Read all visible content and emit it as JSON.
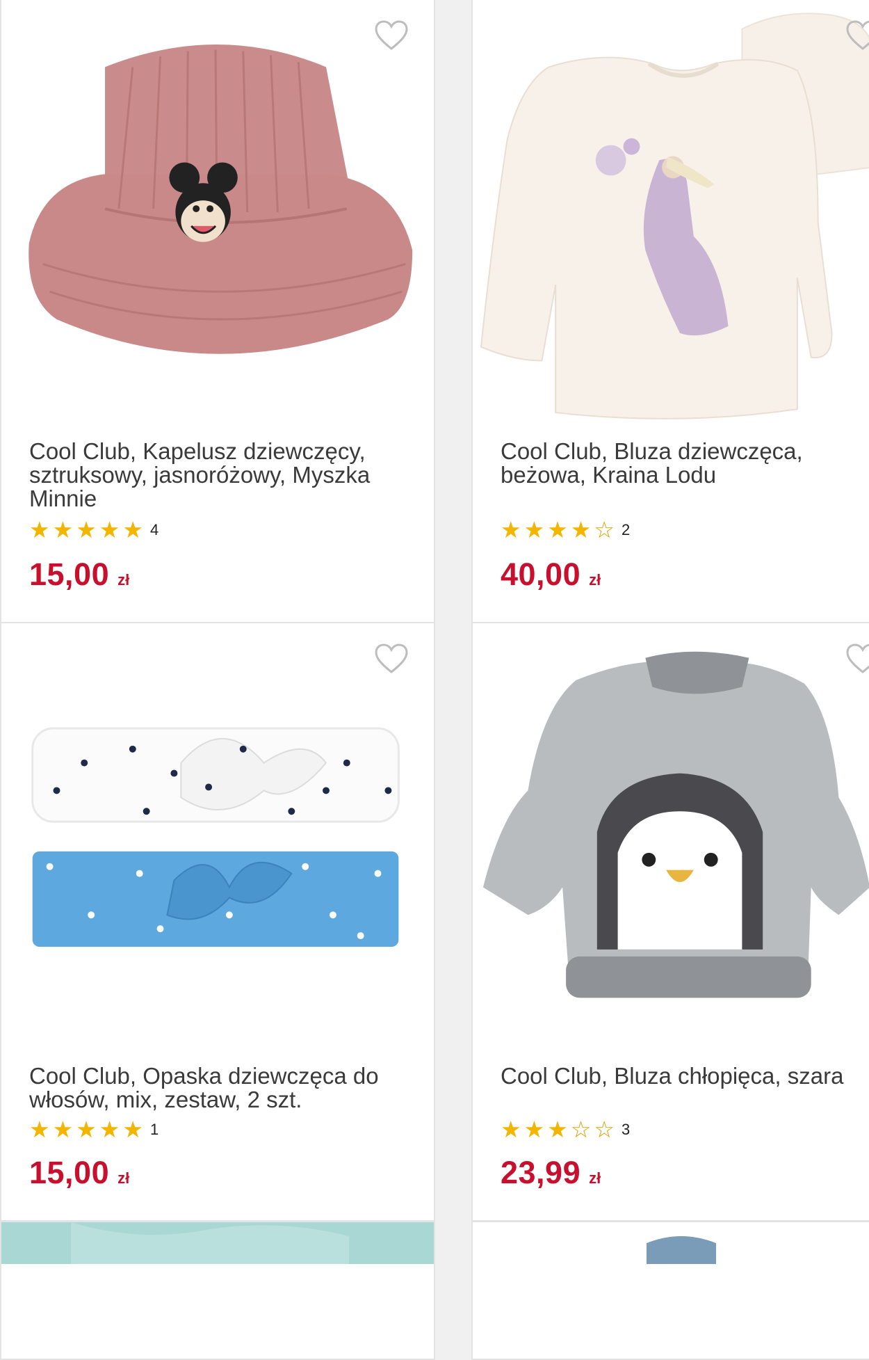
{
  "colors": {
    "price": "#c8102e",
    "star": "#f2b600",
    "border": "#e3e3e3"
  },
  "products": [
    {
      "title": "Cool Club, Kapelusz dziewczęcy, sztruksowy, jasnoróżowy, Myszka Minnie",
      "rating": 5,
      "rating_count": "4",
      "price": "15,00",
      "currency": "zł",
      "image_icon": "bucket-hat-image"
    },
    {
      "title": "Cool Club, Bluza dziewczęca, beżowa, Kraina Lodu",
      "rating": 4,
      "rating_count": "2",
      "price": "40,00",
      "currency": "zł",
      "image_icon": "sweatshirt-image"
    },
    {
      "title": "Cool Club, Opaska dziewczęca do włosów, mix, zestaw, 2 szt.",
      "rating": 5,
      "rating_count": "1",
      "price": "15,00",
      "currency": "zł",
      "image_icon": "headband-image"
    },
    {
      "title": "Cool Club, Bluza chłopięca, szara",
      "rating": 3,
      "rating_count": "3",
      "price": "23,99",
      "currency": "zł",
      "image_icon": "penguin-sweatshirt-image"
    }
  ]
}
